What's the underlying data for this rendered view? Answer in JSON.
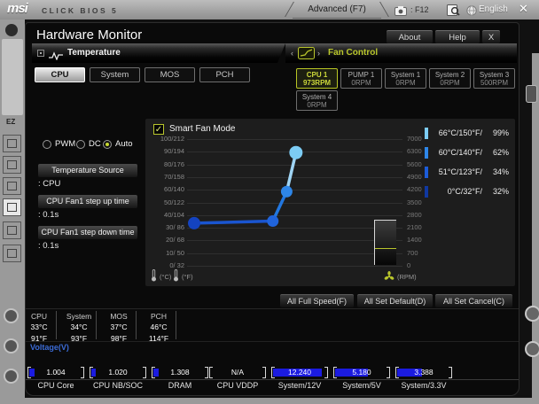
{
  "top_bar": {
    "logo": "msi",
    "product": "CLICK BIOS 5",
    "advanced_label": "Advanced (F7)",
    "screenshot_hint": ": F12",
    "language": "English",
    "close": "✕"
  },
  "dialog": {
    "title": "Hardware Monitor",
    "about_label": "About",
    "help_label": "Help",
    "close_label": "X",
    "temperature_section": "Temperature",
    "fan_control_section": "Fan Control",
    "temp_tabs": {
      "items": [
        "CPU",
        "System",
        "MOS",
        "PCH"
      ],
      "active_index": 0
    },
    "fans": [
      {
        "name": "CPU 1",
        "rpm": "973RPM",
        "active": true
      },
      {
        "name": "PUMP 1",
        "rpm": "0RPM",
        "active": false
      },
      {
        "name": "System 1",
        "rpm": "0RPM",
        "active": false
      },
      {
        "name": "System 2",
        "rpm": "0RPM",
        "active": false
      },
      {
        "name": "System 3",
        "rpm": "500RPM",
        "active": false
      },
      {
        "name": "System 4",
        "rpm": "0RPM",
        "active": false
      }
    ],
    "controls": {
      "modes": [
        "PWM",
        "DC",
        "Auto"
      ],
      "selected_mode": "Auto",
      "fields": [
        {
          "label": "Temperature Source",
          "value": ": CPU"
        },
        {
          "label": "CPU Fan1 step up time",
          "value": ": 0.1s"
        },
        {
          "label": "CPU Fan1 step down time",
          "value": ": 0.1s"
        }
      ]
    },
    "footer_buttons": [
      "All Full Speed(F)",
      "All Set Default(D)",
      "All Set Cancel(C)"
    ]
  },
  "chart_data": {
    "type": "line",
    "title": "Smart Fan Mode",
    "smart_fan_checked": true,
    "x_axis_units": [
      "(°C)",
      "(°F)"
    ],
    "y_right_unit": "(RPM)",
    "left_axis_ticks": [
      "100/212",
      "90/194",
      "80/176",
      "70/158",
      "60/140",
      "50/122",
      "40/104",
      "30/ 86",
      "20/ 68",
      "10/ 50",
      "0/ 32"
    ],
    "right_axis_ticks": [
      "7000",
      "6300",
      "5600",
      "4900",
      "4200",
      "3500",
      "2800",
      "2100",
      "1400",
      "700",
      "0"
    ],
    "x_range_c": [
      0,
      100
    ],
    "duty_range_pct": [
      0,
      100
    ],
    "rpm_range": [
      0,
      7000
    ],
    "points": [
      {
        "temp_c": 0,
        "duty_pct": 32,
        "color": "#1443c0",
        "r": 7
      },
      {
        "temp_c": 51,
        "duty_pct": 34,
        "color": "#2064dc",
        "r": 6.5
      },
      {
        "temp_c": 60,
        "duty_pct": 62,
        "color": "#2e86e8",
        "r": 6.5
      },
      {
        "temp_c": 66,
        "duty_pct": 99,
        "color": "#7cccf4",
        "r": 7.5
      }
    ],
    "segment_colors": [
      "#1a55d0",
      "#2277e0",
      "#9fd4f4"
    ],
    "current_rpm": 973,
    "curve_table": [
      {
        "color": "#7cccf4",
        "label": "66°C/150°F/",
        "percent": "99%"
      },
      {
        "color": "#2e86e8",
        "label": "60°C/140°F/",
        "percent": "62%"
      },
      {
        "color": "#1c5cd8",
        "label": "51°C/123°F/",
        "percent": "34%"
      },
      {
        "color": "#1038a0",
        "label": "0°C/32°F/",
        "percent": "32%"
      }
    ]
  },
  "status": {
    "temps": [
      {
        "name": "CPU",
        "c": "33°C",
        "f": "91°F"
      },
      {
        "name": "System",
        "c": "34°C",
        "f": "93°F"
      },
      {
        "name": "MOS",
        "c": "37°C",
        "f": "98°F"
      },
      {
        "name": "PCH",
        "c": "46°C",
        "f": "114°F"
      }
    ],
    "voltage_title": "Voltage(V)",
    "voltages": [
      {
        "value": "1.004",
        "label": "CPU Core",
        "fill_pct": 9
      },
      {
        "value": "1.020",
        "label": "CPU NB/SOC",
        "fill_pct": 8
      },
      {
        "value": "1.308",
        "label": "DRAM",
        "fill_pct": 10
      },
      {
        "value": "N/A",
        "label": "CPU VDDP",
        "fill_pct": 0
      },
      {
        "value": "12.240",
        "label": "System/12V",
        "fill_pct": 88
      },
      {
        "value": "5.180",
        "label": "System/5V",
        "fill_pct": 60
      },
      {
        "value": "3.388",
        "label": "System/3.3V",
        "fill_pct": 45
      }
    ]
  },
  "sidebar": {
    "ez_label": "EZ"
  }
}
